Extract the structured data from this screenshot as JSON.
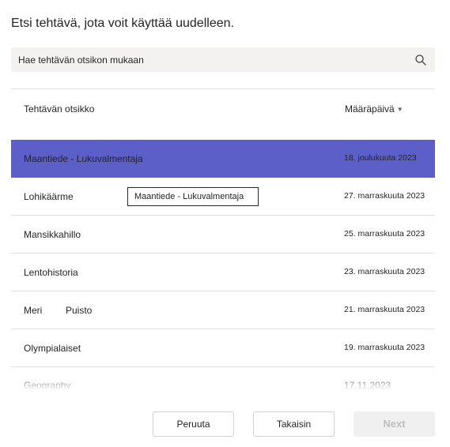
{
  "dialog": {
    "title": "Etsi tehtävä, jota voit käyttää uudelleen."
  },
  "search": {
    "placeholder": "Hae tehtävän otsikon mukaan",
    "icon": "search-icon"
  },
  "table": {
    "columns": {
      "title": "Tehtävän otsikko",
      "due_date": "Määräpäivä",
      "sort_icon": "caret-down-icon"
    },
    "rows": [
      {
        "title": "Maantiede - Lukuvalmentaja",
        "date": "18. joulukuuta 2023",
        "selected": true
      },
      {
        "title": "Lohikäärme",
        "date": "27. marraskuuta 2023"
      },
      {
        "title": "Mansikkahillo",
        "date": "25. marraskuuta 2023"
      },
      {
        "title": "Lentohistoria",
        "date": "23. marraskuuta 2023"
      },
      {
        "title": "Meri",
        "title_extra": "Puisto",
        "date": "21. marraskuuta 2023"
      },
      {
        "title": "Olympialaiset",
        "date": "19. marraskuuta 2023"
      },
      {
        "title": "Geography",
        "date": "17.11.2023"
      }
    ],
    "selection_color": "#5b5fc7"
  },
  "tooltip": {
    "text": "Maantiede - Lukuvalmentaja"
  },
  "footer": {
    "cancel_label": "Peruuta",
    "back_label": "Takaisin",
    "next_label": "Next",
    "next_enabled": false
  }
}
